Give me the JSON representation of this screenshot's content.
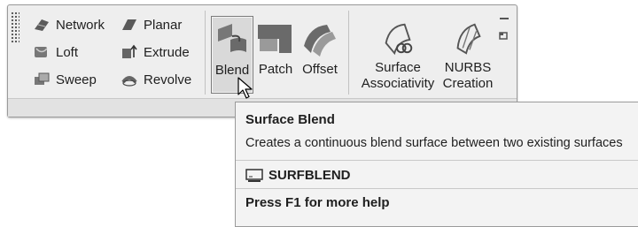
{
  "ribbon": {
    "create_small": [
      {
        "label": "Network",
        "icon": "network-surface-icon"
      },
      {
        "label": "Loft",
        "icon": "loft-icon"
      },
      {
        "label": "Sweep",
        "icon": "sweep-icon"
      }
    ],
    "create_small_col2": [
      {
        "label": "Planar",
        "icon": "planar-surface-icon"
      },
      {
        "label": "Extrude",
        "icon": "extrude-icon"
      },
      {
        "label": "Revolve",
        "icon": "revolve-icon"
      }
    ],
    "edit_large": [
      {
        "label": "Blend",
        "icon": "blend-icon",
        "active": true
      },
      {
        "label": "Patch",
        "icon": "patch-icon"
      },
      {
        "label": "Offset",
        "icon": "offset-icon"
      }
    ],
    "assoc_large": [
      {
        "line1": "Surface",
        "line2": "Associativity",
        "icon": "surface-associativity-icon"
      },
      {
        "line1": "NURBS",
        "line2": "Creation",
        "icon": "nurbs-creation-icon"
      }
    ]
  },
  "tooltip": {
    "title": "Surface Blend",
    "description": "Creates a continuous blend surface between two existing surfaces",
    "command": "SURFBLEND",
    "help": "Press F1 for more help"
  },
  "colors": {
    "panel": "#eeeeee",
    "icon_dark": "#4a4a4a",
    "icon_mid": "#8c8c8c",
    "tooltip_bg": "#f3f3f3"
  }
}
